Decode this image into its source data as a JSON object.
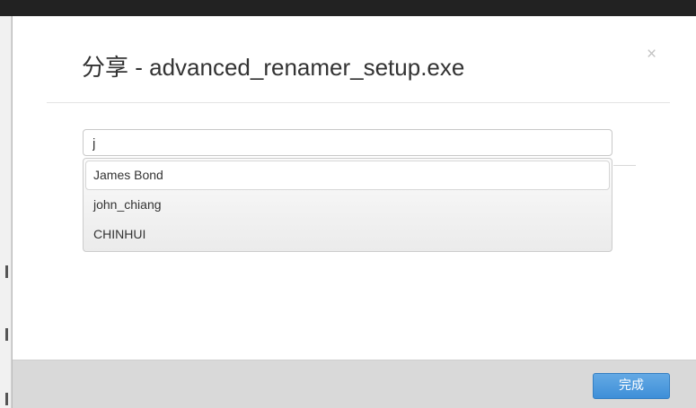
{
  "modal": {
    "title": "分享 - advanced_renamer_setup.exe",
    "close_icon": "close-icon",
    "close_glyph": "×"
  },
  "search": {
    "value": "j",
    "placeholder": ""
  },
  "suggestions": [
    {
      "label": "James Bond",
      "active": true
    },
    {
      "label": "john_chiang",
      "active": false
    },
    {
      "label": "CHINHUI",
      "active": false
    }
  ],
  "footer": {
    "done_label": "完成"
  },
  "colors": {
    "accent": "#4a97dc",
    "footer_bg": "#d9d9d9",
    "title_text": "#333333"
  }
}
